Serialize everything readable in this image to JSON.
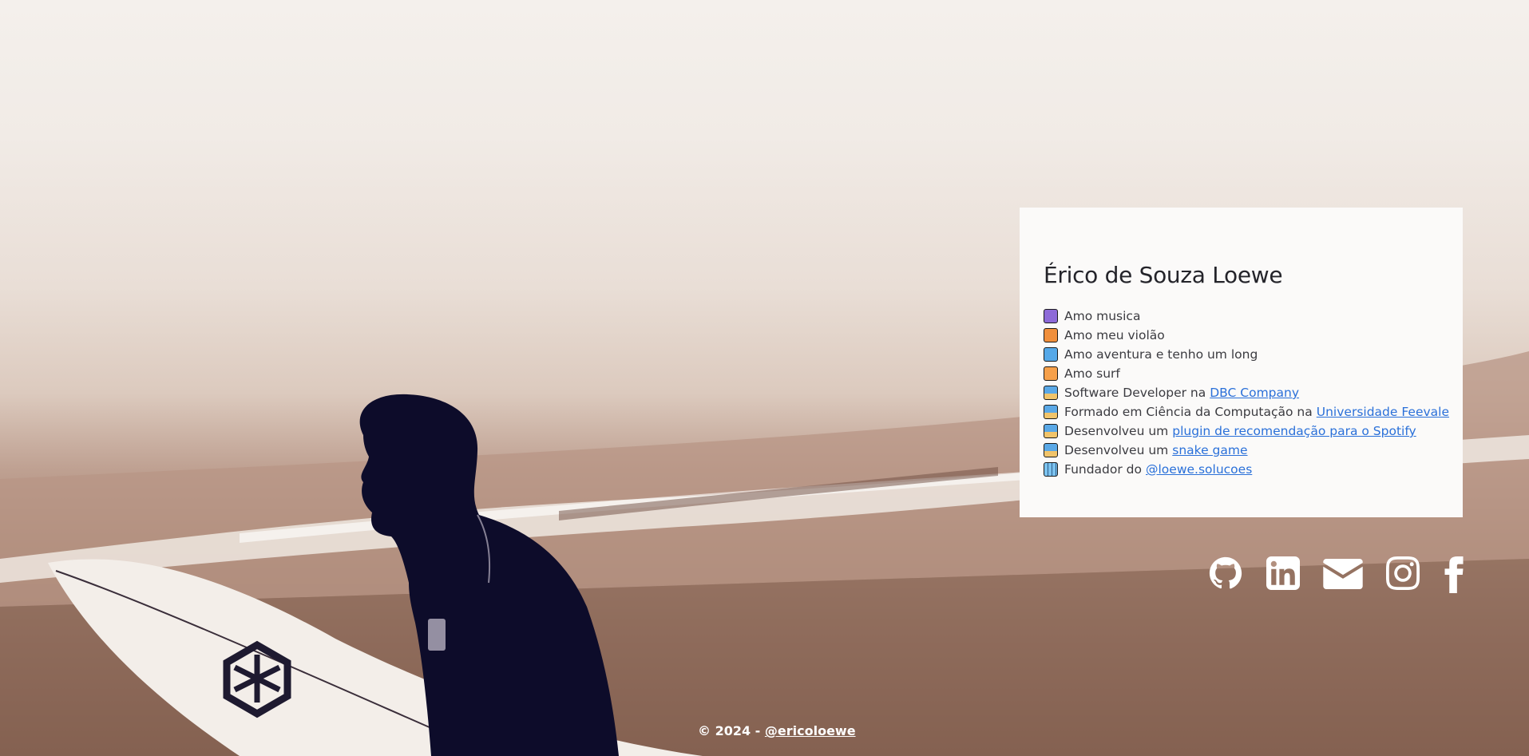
{
  "profile": {
    "name": "Érico de Souza Loewe",
    "items": [
      {
        "icon": "musical-note-emoji",
        "text": "Amo musica",
        "link": ""
      },
      {
        "icon": "guitar-emoji",
        "text": "Amo meu violão",
        "link": ""
      },
      {
        "icon": "skateboard-emoji",
        "text": "Amo aventura e tenho um long",
        "link": ""
      },
      {
        "icon": "surfer-emoji",
        "text": "Amo surf",
        "link": ""
      },
      {
        "icon": "technologist-emoji",
        "text": "Software Developer na",
        "link": "DBC Company"
      },
      {
        "icon": "technologist-emoji",
        "text": "Formado em Ciência da Computação na",
        "link": "Universidade Feevale"
      },
      {
        "icon": "technologist-emoji",
        "text": "Desenvolveu um",
        "link": "plugin de recomendação para o Spotify"
      },
      {
        "icon": "technologist-emoji",
        "text": "Desenvolveu um",
        "link": "snake game"
      },
      {
        "icon": "office-building-emoji",
        "text": "Fundador do",
        "link": "@loewe.solucoes"
      }
    ]
  },
  "social": [
    "github-icon",
    "linkedin-icon",
    "envelope-icon",
    "instagram-icon",
    "facebook-icon"
  ],
  "footer": {
    "copyright": "© 2024 -",
    "handle": "@ericoloewe"
  },
  "colors": {
    "link": "#2a70d9",
    "card": "#fbfaf9",
    "heading": "#24242a"
  }
}
